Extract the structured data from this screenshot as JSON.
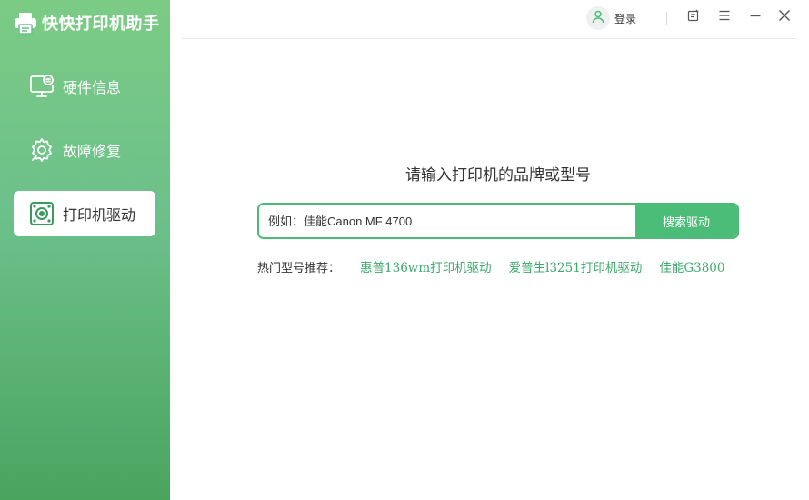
{
  "app": {
    "title": "快快打印机助手",
    "icon": "printer-icon"
  },
  "sidebar": {
    "items": [
      {
        "label": "硬件信息",
        "icon": "monitor-info-icon",
        "active": false
      },
      {
        "label": "故障修复",
        "icon": "repair-gear-icon",
        "active": false
      },
      {
        "label": "打印机驱动",
        "icon": "printer-driver-icon",
        "active": true
      }
    ]
  },
  "topbar": {
    "login_label": "登录",
    "avatar_icon": "user-icon",
    "buttons": [
      "feedback-icon",
      "menu-icon",
      "minimize-icon",
      "close-icon"
    ]
  },
  "main": {
    "prompt": "请输入打印机的品牌或型号",
    "search": {
      "placeholder": "例如：佳能Canon MF 4700",
      "value": "",
      "button_label": "搜索驱动"
    },
    "hot": {
      "label": "热门型号推荐：",
      "links": [
        "惠普136wm打印机驱动",
        "爱普生l3251打印机驱动",
        "佳能G3800"
      ]
    }
  },
  "colors": {
    "accent": "#4cbd78",
    "link": "#3daa6b",
    "sidebar_top": "#7ccb85",
    "sidebar_bottom": "#4aa45e"
  }
}
